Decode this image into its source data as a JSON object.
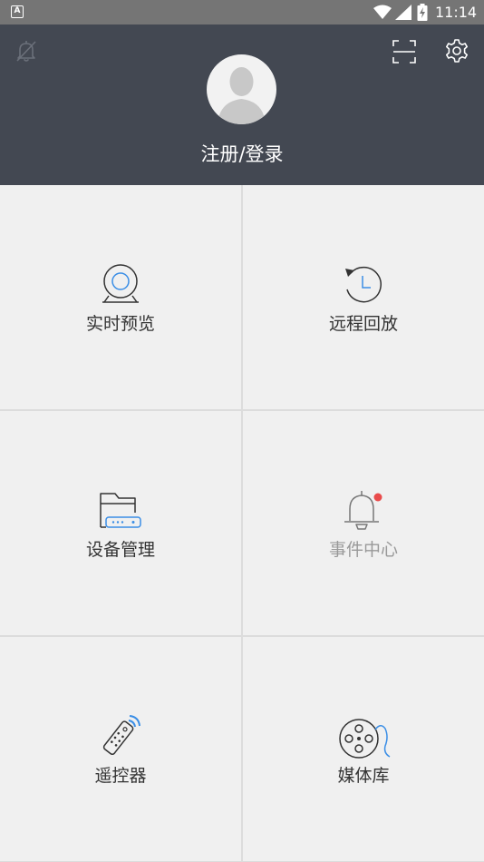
{
  "status_bar": {
    "time": "11:14",
    "notification_glyph": "A"
  },
  "header": {
    "login_label": "注册/登录",
    "icons": [
      "bell-off-icon",
      "scan-icon",
      "gear-icon",
      "avatar-icon"
    ]
  },
  "menu": {
    "items": [
      {
        "label": "实时预览",
        "icon": "webcam-icon",
        "enabled": true
      },
      {
        "label": "远程回放",
        "icon": "clock-history-icon",
        "enabled": true
      },
      {
        "label": "设备管理",
        "icon": "device-folder-icon",
        "enabled": true
      },
      {
        "label": "事件中心",
        "icon": "bell-icon",
        "enabled": false
      },
      {
        "label": "遥控器",
        "icon": "remote-control-icon",
        "enabled": true
      },
      {
        "label": "媒体库",
        "icon": "film-reel-icon",
        "enabled": true
      }
    ]
  },
  "colors": {
    "header_bg": "#434852",
    "status_bg": "#757575",
    "accent_blue": "#3a8ee6",
    "badge_red": "#e94b4b",
    "cell_bg": "#f0f0f0"
  }
}
